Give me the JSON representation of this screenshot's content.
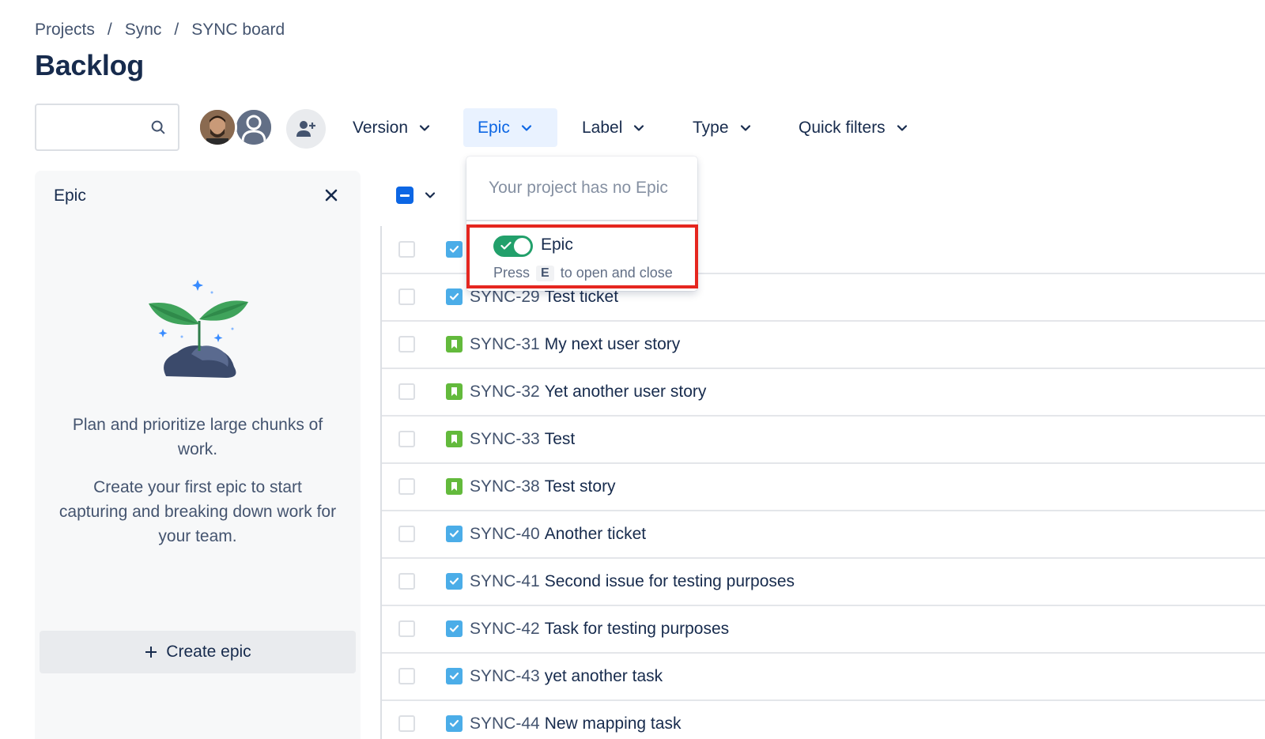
{
  "breadcrumb": {
    "items": [
      "Projects",
      "Sync",
      "SYNC board"
    ],
    "separator": "/"
  },
  "page": {
    "title": "Backlog"
  },
  "search": {
    "value": "",
    "placeholder": ""
  },
  "filters": {
    "version": "Version",
    "epic": "Epic",
    "label": "Label",
    "type": "Type",
    "quick": "Quick filters"
  },
  "epic_panel": {
    "title": "Epic",
    "text1": "Plan and prioritize large chunks of work.",
    "text2": "Create your first epic to start capturing and breaking down work for your team.",
    "create_label": "Create epic"
  },
  "dropdown": {
    "empty_text": "Your project has no Epic",
    "toggle_label": "Epic",
    "toggle_on": true,
    "hint_before": "Press",
    "hint_key": "E",
    "hint_after": "to open and close"
  },
  "issues": [
    {
      "key": "",
      "summary": "",
      "type": "task"
    },
    {
      "key": "SYNC-29",
      "summary": "Test ticket",
      "type": "task"
    },
    {
      "key": "SYNC-31",
      "summary": "My next user story",
      "type": "story"
    },
    {
      "key": "SYNC-32",
      "summary": "Yet another user story",
      "type": "story"
    },
    {
      "key": "SYNC-33",
      "summary": "Test",
      "type": "story"
    },
    {
      "key": "SYNC-38",
      "summary": "Test story",
      "type": "story"
    },
    {
      "key": "SYNC-40",
      "summary": "Another ticket",
      "type": "task"
    },
    {
      "key": "SYNC-41",
      "summary": "Second issue for testing purposes",
      "type": "task"
    },
    {
      "key": "SYNC-42",
      "summary": "Task for testing purposes",
      "type": "task"
    },
    {
      "key": "SYNC-43",
      "summary": "yet another task",
      "type": "task"
    },
    {
      "key": "SYNC-44",
      "summary": "New mapping task",
      "type": "task"
    }
  ],
  "colors": {
    "accent": "#0c66e4",
    "toggle_on": "#22a06b",
    "highlight": "#e5261f",
    "task_icon": "#4bade8",
    "story_icon": "#63ba3c"
  }
}
